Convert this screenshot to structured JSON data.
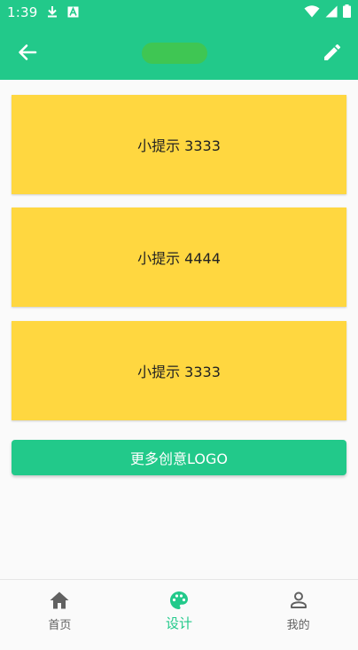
{
  "status_bar": {
    "time": "1:39",
    "icons": [
      "download-icon",
      "a-badge-icon",
      "wifi-icon",
      "signal-icon",
      "battery-icon"
    ]
  },
  "app_bar": {
    "back_icon": "arrow-left-icon",
    "edit_icon": "pencil-icon"
  },
  "cards": [
    {
      "text": "小提示 3333"
    },
    {
      "text": "小提示 4444"
    },
    {
      "text": "小提示 3333"
    }
  ],
  "more_button": {
    "label": "更多创意LOGO"
  },
  "bottom_nav": {
    "items": [
      {
        "label": "首页",
        "icon": "home-icon"
      },
      {
        "label": "设计",
        "icon": "palette-icon",
        "active": true
      },
      {
        "label": "我的",
        "icon": "person-icon"
      }
    ]
  },
  "colors": {
    "primary": "#22C98A",
    "card": "#FFD740",
    "title_pill": "#3FC653"
  }
}
